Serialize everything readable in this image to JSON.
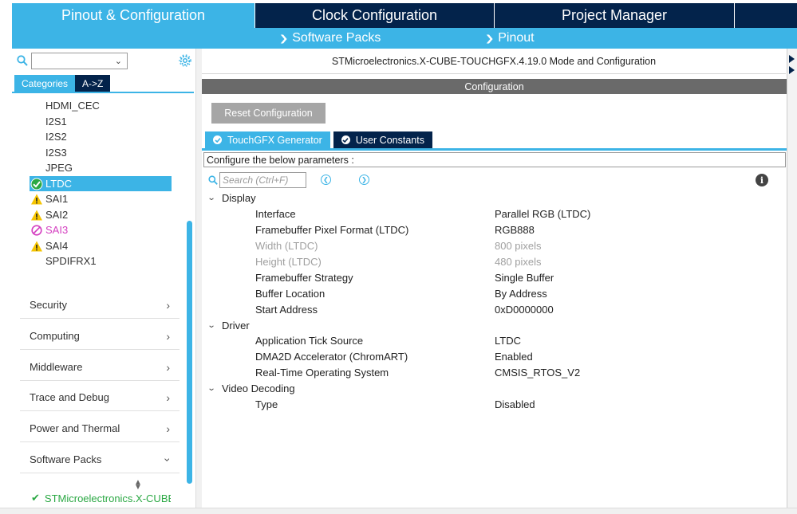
{
  "header": {
    "tabs": [
      {
        "label": "Pinout & Configuration",
        "active": true
      },
      {
        "label": "Clock Configuration",
        "active": false
      },
      {
        "label": "Project Manager",
        "active": false
      }
    ],
    "sub_links": [
      {
        "label": "Software Packs",
        "icon": "chevron-down-icon"
      },
      {
        "label": "Pinout",
        "icon": "chevron-down-icon"
      }
    ]
  },
  "left_panel": {
    "search": {
      "value": "",
      "icon": "search-icon"
    },
    "view_tabs": [
      {
        "label": "Categories",
        "active": true
      },
      {
        "label": "A->Z",
        "active": false
      }
    ],
    "peripherals": [
      {
        "label": "HDMI_CEC",
        "status": "none"
      },
      {
        "label": "I2S1",
        "status": "none"
      },
      {
        "label": "I2S2",
        "status": "none"
      },
      {
        "label": "I2S3",
        "status": "none"
      },
      {
        "label": "JPEG",
        "status": "none"
      },
      {
        "label": "LTDC",
        "status": "ok",
        "selected": true
      },
      {
        "label": "SAI1",
        "status": "warning"
      },
      {
        "label": "SAI2",
        "status": "warning"
      },
      {
        "label": "SAI3",
        "status": "blocked"
      },
      {
        "label": "SAI4",
        "status": "warning"
      },
      {
        "label": "SPDIFRX1",
        "status": "none"
      }
    ],
    "categories": [
      {
        "label": "Security",
        "arrow": "chevron-right-icon"
      },
      {
        "label": "Computing",
        "arrow": "chevron-right-icon"
      },
      {
        "label": "Middleware",
        "arrow": "chevron-right-icon"
      },
      {
        "label": "Trace and Debug",
        "arrow": "chevron-right-icon"
      },
      {
        "label": "Power and Thermal",
        "arrow": "chevron-right-icon"
      },
      {
        "label": "Software Packs",
        "arrow": "chevron-down-icon"
      }
    ],
    "pack_item": "STMicroelectronics.X-CUBE"
  },
  "right_panel": {
    "mode_title": "STMicroelectronics.X-CUBE-TOUCHGFX.4.19.0 Mode and Configuration",
    "config_title": "Configuration",
    "reset_label": "Reset Configuration",
    "tabs": [
      {
        "label": "TouchGFX Generator",
        "active": true
      },
      {
        "label": "User Constants",
        "active": false
      }
    ],
    "configure_text": "Configure the below parameters :",
    "param_search_placeholder": "Search (Ctrl+F)",
    "groups": [
      {
        "label": "Display",
        "params": [
          {
            "name": "Interface",
            "value": "Parallel RGB (LTDC)",
            "disabled": false
          },
          {
            "name": "Framebuffer Pixel Format (LTDC)",
            "value": "RGB888",
            "disabled": false
          },
          {
            "name": "Width (LTDC)",
            "value": "800 pixels",
            "disabled": true
          },
          {
            "name": "Height (LTDC)",
            "value": "480 pixels",
            "disabled": true
          },
          {
            "name": "Framebuffer Strategy",
            "value": "Single Buffer",
            "disabled": false
          },
          {
            "name": "Buffer Location",
            "value": "By Address",
            "disabled": false
          },
          {
            "name": "Start Address",
            "value": "0xD0000000",
            "disabled": false
          }
        ]
      },
      {
        "label": "Driver",
        "params": [
          {
            "name": "Application Tick Source",
            "value": "LTDC",
            "disabled": false
          },
          {
            "name": "DMA2D Accelerator (ChromART)",
            "value": "Enabled",
            "disabled": false
          },
          {
            "name": "Real-Time Operating System",
            "value": "CMSIS_RTOS_V2",
            "disabled": false
          }
        ]
      },
      {
        "label": "Video Decoding",
        "params": [
          {
            "name": "Type",
            "value": "Disabled",
            "disabled": false
          }
        ]
      }
    ]
  },
  "colors": {
    "accent": "#3cb4e6",
    "navy": "#03234b",
    "config_bar": "#6a6a6a",
    "reset_button": "#a6a6a6",
    "ok_green": "#2aa843",
    "warning_yellow": "#f5c400",
    "blocked_pink": "#d43ec0"
  }
}
